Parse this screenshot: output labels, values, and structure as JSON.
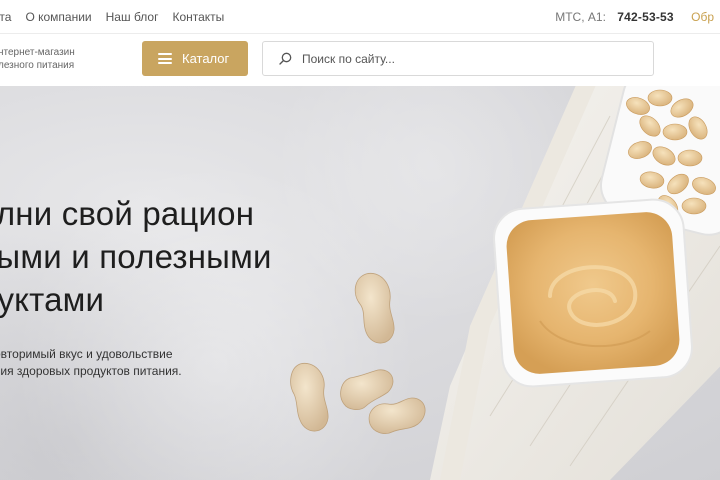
{
  "topnav": {
    "items": [
      "лата",
      "О компании",
      "Наш блог",
      "Контакты"
    ]
  },
  "contact": {
    "operator": "МТС, A1:",
    "phone": "742-53-53",
    "callback": "Обр"
  },
  "header": {
    "tagline": "нтернет-магазин\nлезного питания",
    "catalog_label": "Каталог",
    "search_placeholder": "Поиск по сайту..."
  },
  "hero": {
    "title_line1": "олни свой рацион",
    "title_line2": "ными и полезными",
    "title_line3": "дуктами",
    "subtitle_line1": "овторимый вкус и удовольствие",
    "subtitle_line2": "вия здоровых продуктов питания."
  },
  "colors": {
    "accent": "#c9a560",
    "callback": "#c9a14f"
  }
}
